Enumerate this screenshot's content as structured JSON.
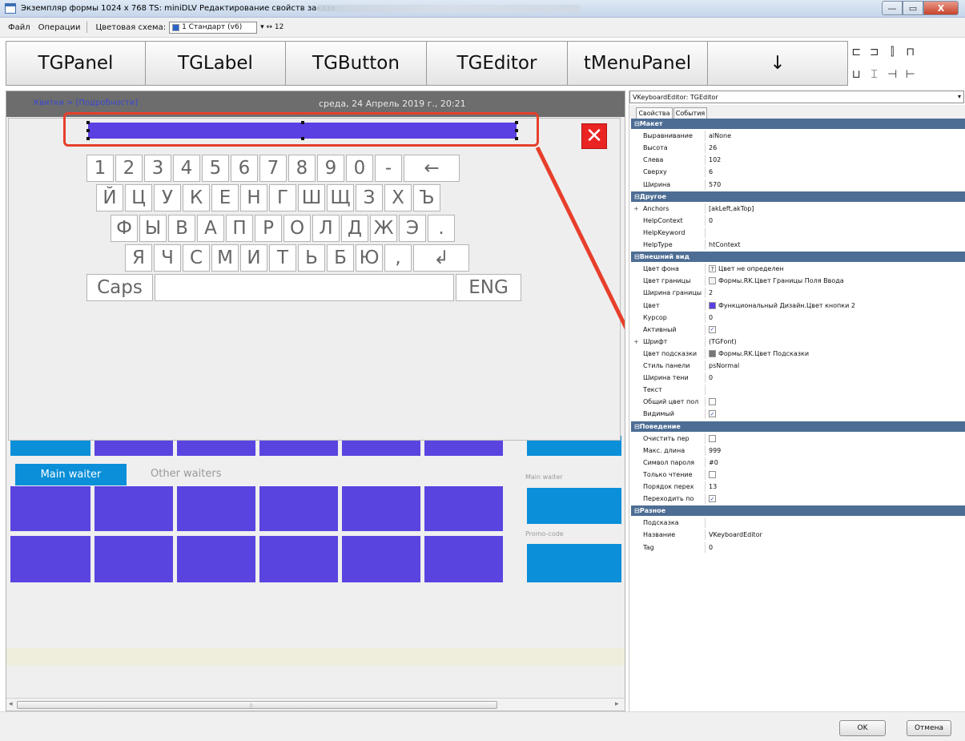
{
  "window": {
    "title": "Экземпляр формы 1024 x 768 TS: miniDLV Редактирование свойств заказа",
    "controls": {
      "minimize": "—",
      "maximize": "▭",
      "close": "X"
    }
  },
  "menu": {
    "file": "Файл",
    "operations": "Операции",
    "scheme_label": "Цветовая схема:",
    "scheme_value": "1 Стандарт (v6)",
    "zoom_value": "12"
  },
  "toolbar": {
    "buttons": [
      "TGPanel",
      "TGLabel",
      "TGButton",
      "TGEditor",
      "tMenuPanel",
      "↓"
    ]
  },
  "canvas": {
    "breadcrumb": "Квитки > [Подробности]",
    "datetime": "среда, 24 Апрель 2019 г., 20:21",
    "tab_main": "Main waiter",
    "tab_other": "Other waiters",
    "side_label_1": "Main waiter",
    "side_label_2": "Promo-code"
  },
  "keyboard": {
    "close": "✕",
    "row1": [
      "1",
      "2",
      "3",
      "4",
      "5",
      "6",
      "7",
      "8",
      "9",
      "0",
      "-",
      "←"
    ],
    "row2": [
      "Й",
      "Ц",
      "У",
      "К",
      "Е",
      "Н",
      "Г",
      "Ш",
      "Щ",
      "З",
      "Х",
      "Ъ"
    ],
    "row3": [
      "Ф",
      "Ы",
      "В",
      "А",
      "П",
      "Р",
      "О",
      "Л",
      "Д",
      "Ж",
      "Э",
      "."
    ],
    "row4": [
      "Я",
      "Ч",
      "С",
      "М",
      "И",
      "Т",
      "Ь",
      "Б",
      "Ю",
      ",",
      "↲"
    ],
    "caps": "Caps",
    "space": "",
    "lang": "ENG"
  },
  "inspector": {
    "object": "VKeyboardEditor: TGEditor",
    "tab_props": "Свойства",
    "tab_events": "События",
    "rows": [
      {
        "type": "cat",
        "label": "Макет"
      },
      {
        "k": "Выравнивание",
        "v": "alNone"
      },
      {
        "k": "Высота",
        "v": "26"
      },
      {
        "k": "Слева",
        "v": "102"
      },
      {
        "k": "Сверху",
        "v": "6"
      },
      {
        "k": "Ширина",
        "v": "570"
      },
      {
        "type": "cat",
        "label": "Другое"
      },
      {
        "k": "Anchors",
        "v": "[akLeft,akTop]",
        "plus": "+"
      },
      {
        "k": "HelpContext",
        "v": "0"
      },
      {
        "k": "HelpKeyword",
        "v": ""
      },
      {
        "k": "HelpType",
        "v": "htContext"
      },
      {
        "type": "cat",
        "label": "Внешний вид"
      },
      {
        "k": "Цвет фона",
        "v": "Цвет не определен",
        "swatch": "?"
      },
      {
        "k": "Цвет границы",
        "v": "Формы.RK.Цвет Границы Поля Ввода",
        "swatch": "#f2f2f2"
      },
      {
        "k": "Ширина границы",
        "v": "2"
      },
      {
        "k": "Цвет",
        "v": "Функциональный Дизайн.Цвет кнопки 2",
        "swatch": "#5a3fe3"
      },
      {
        "k": "Курсор",
        "v": "0"
      },
      {
        "k": "Активный",
        "v": "",
        "check": true
      },
      {
        "k": "Шрифт",
        "v": "(TGFont)",
        "plus": "+"
      },
      {
        "k": "Цвет подсказки",
        "v": "Формы.RK.Цвет Подсказки",
        "swatch": "#777777"
      },
      {
        "k": "Стиль панели",
        "v": "psNormal"
      },
      {
        "k": "Ширина тени",
        "v": "0"
      },
      {
        "k": "Текст",
        "v": ""
      },
      {
        "k": "Общий цвет пол",
        "v": "",
        "check": false
      },
      {
        "k": "Видимый",
        "v": "",
        "check": true
      },
      {
        "type": "cat",
        "label": "Поведение"
      },
      {
        "k": "Очистить пер",
        "v": "",
        "check": false
      },
      {
        "k": "Макс. длина",
        "v": "999"
      },
      {
        "k": "Символ пароля",
        "v": "#0"
      },
      {
        "k": "Только чтение",
        "v": "",
        "check": false
      },
      {
        "k": "Порядок перех",
        "v": "13"
      },
      {
        "k": "Переходить по",
        "v": "",
        "check": true
      },
      {
        "type": "cat",
        "label": "Разное"
      },
      {
        "k": "Подсказка",
        "v": ""
      },
      {
        "k": "Название",
        "v": "VKeyboardEditor"
      },
      {
        "k": "Tag",
        "v": "0"
      }
    ]
  },
  "dialog": {
    "ok": "OK",
    "cancel": "Отмена"
  },
  "colors": {
    "accent": "#5a3fe3",
    "tile_blue": "#0a8fd8",
    "annotation": "#e73f2c"
  }
}
